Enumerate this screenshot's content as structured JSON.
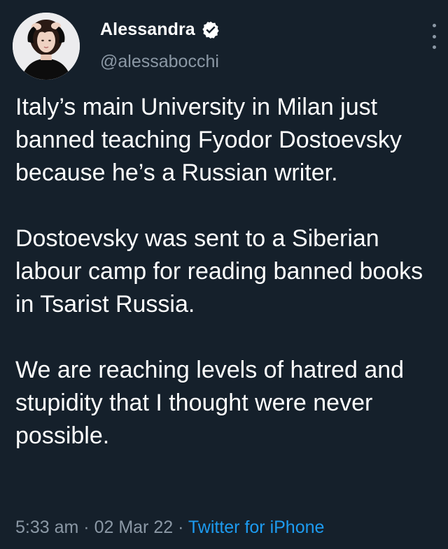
{
  "tweet": {
    "author": {
      "name": "Alessandra",
      "handle": "@alessabocchi",
      "verified": true
    },
    "paragraphs": [
      "Italy’s main University in Milan just banned teaching Fyodor Dostoevsky because he’s a Russian writer.",
      "Dostoevsky was sent to a Siberian labour camp for reading banned books in Tsarist Russia.",
      "We are reaching levels of hatred and stupidity that I thought were never possible."
    ],
    "meta": {
      "time": "5:33 am",
      "date": "02 Mar 22",
      "separator": " · ",
      "source": "Twitter for iPhone"
    },
    "colors": {
      "background": "#15202b",
      "text": "#ffffff",
      "secondary_text": "#8b98a5",
      "link": "#1d9bf0"
    },
    "icons": {
      "verified": "verified-badge-icon",
      "more": "more-options-icon"
    }
  }
}
